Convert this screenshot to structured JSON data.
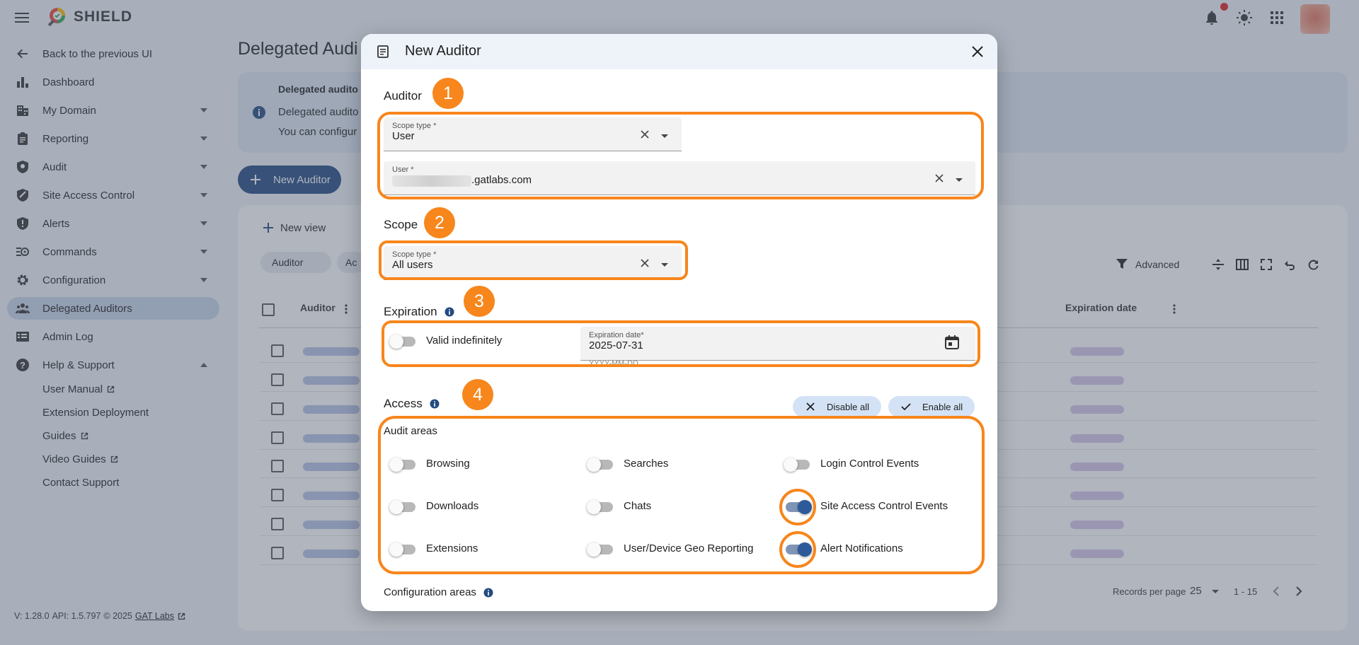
{
  "app": {
    "brand": "SHIELD"
  },
  "sidebar": {
    "items": [
      {
        "label": "Back to the previous UI",
        "icon": "arrow-left-icon"
      },
      {
        "label": "Dashboard",
        "icon": "bar-chart-icon"
      },
      {
        "label": "My Domain",
        "icon": "building-icon"
      },
      {
        "label": "Reporting",
        "icon": "clipboard-icon"
      },
      {
        "label": "Audit",
        "icon": "shield-search-icon"
      },
      {
        "label": "Site Access Control",
        "icon": "shield-lock-icon"
      },
      {
        "label": "Alerts",
        "icon": "shield-alert-icon"
      },
      {
        "label": "Commands",
        "icon": "commands-icon"
      },
      {
        "label": "Configuration",
        "icon": "gear-icon"
      },
      {
        "label": "Delegated Auditors",
        "icon": "people-icon"
      },
      {
        "label": "Admin Log",
        "icon": "log-icon"
      },
      {
        "label": "Help & Support",
        "icon": "help-icon"
      }
    ],
    "help_sub": [
      "User Manual",
      "Extension Deployment",
      "Guides",
      "Video Guides",
      "Contact Support"
    ],
    "version": {
      "v": "V: 1.28.0",
      "api": "API: 1.5.797",
      "copyright": "© 2025",
      "link": "GAT Labs"
    }
  },
  "page": {
    "title": "Delegated Audi",
    "info_title": "Delegated audito",
    "info_line1": "Delegated audito",
    "info_line2": "You can configur",
    "new_auditor_button": "New Auditor",
    "new_view": "New view",
    "chips": [
      "Auditor",
      "Ac"
    ],
    "advanced": "Advanced",
    "col_auditor": "Auditor",
    "col_expiration": "Expiration date",
    "records_per_page_label": "Records per page",
    "records_per_page": "25",
    "range": "1 - 15"
  },
  "dialog": {
    "title": "New Auditor",
    "auditor": {
      "heading": "Auditor",
      "badge": "1",
      "scope_type_label": "Scope type *",
      "scope_type_value": "User",
      "user_label": "User *",
      "user_value": ".gatlabs.com"
    },
    "scope": {
      "heading": "Scope",
      "badge": "2",
      "scope_type_label": "Scope type *",
      "scope_type_value": "All users"
    },
    "expiration": {
      "heading": "Expiration",
      "badge": "3",
      "valid_indefinitely": "Valid indefinitely",
      "date_label": "Expiration date*",
      "date_value": "2025-07-31",
      "date_hint": "YYYY-MM-DD"
    },
    "access": {
      "heading": "Access",
      "badge": "4",
      "disable_all": "Disable all",
      "enable_all": "Enable all",
      "audit_areas_heading": "Audit areas",
      "areas": [
        {
          "label": "Browsing",
          "on": false
        },
        {
          "label": "Searches",
          "on": false
        },
        {
          "label": "Login Control Events",
          "on": false
        },
        {
          "label": "Downloads",
          "on": false
        },
        {
          "label": "Chats",
          "on": false
        },
        {
          "label": "Site Access Control Events",
          "on": true
        },
        {
          "label": "Extensions",
          "on": false
        },
        {
          "label": "User/Device Geo Reporting",
          "on": false
        },
        {
          "label": "Alert Notifications",
          "on": true
        }
      ],
      "configuration_areas_heading": "Configuration areas"
    }
  },
  "colors": {
    "accent_orange": "#f7861c",
    "primary_blue": "#244a80",
    "toggle_on": "#2d5a99",
    "notification_dot": "#e0201f"
  }
}
